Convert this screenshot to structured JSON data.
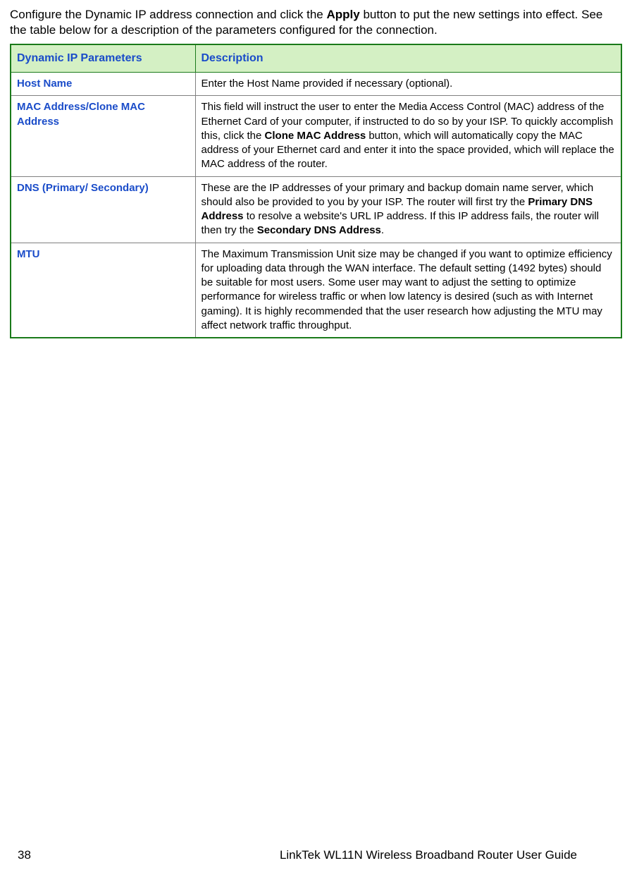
{
  "intro": {
    "prefix": "Configure the Dynamic IP address connection and click the ",
    "bold1": "Apply",
    "suffix": " button to put the new settings into effect. See the table below for a description of the parameters configured for the connection."
  },
  "table": {
    "headers": {
      "param": "Dynamic IP Parameters",
      "desc": "Description"
    },
    "rows": [
      {
        "param": "Host Name",
        "desc_plain": "Enter the Host Name provided if necessary (optional)."
      },
      {
        "param": "MAC Address/Clone MAC Address",
        "desc_parts": {
          "p1": "This field will instruct the user to enter the Media Access Control (MAC) address of the Ethernet Card of your computer, if instructed to do so by your ISP. To quickly accomplish this, click the ",
          "b1": "Clone MAC Address",
          "p2": " button, which will automatically copy the MAC address of your Ethernet card and enter it into the space provided, which will replace the MAC address of the router."
        }
      },
      {
        "param": "DNS (Primary/ Secondary)",
        "desc_parts": {
          "p1": "These are the IP addresses of your primary and backup domain name server, which should also be provided to you by your ISP. The router will first try the ",
          "b1": "Primary DNS Address",
          "p2": " to resolve a website's URL IP address. If this IP address fails, the router will then try the ",
          "b2": "Secondary DNS Address",
          "p3": "."
        }
      },
      {
        "param": "MTU",
        "desc_plain": "The Maximum Transmission Unit size may be changed if you want to optimize efficiency for uploading data through the WAN interface. The default setting (1492 bytes) should be suitable for most users. Some user may want to adjust the setting to optimize performance for wireless traffic or when low latency is desired (such as with Internet gaming). It is highly recommended that the user research how adjusting the MTU may affect network traffic throughput."
      }
    ]
  },
  "footer": {
    "page": "38",
    "title": "LinkTek WL11N Wireless Broadband Router User Guide"
  }
}
